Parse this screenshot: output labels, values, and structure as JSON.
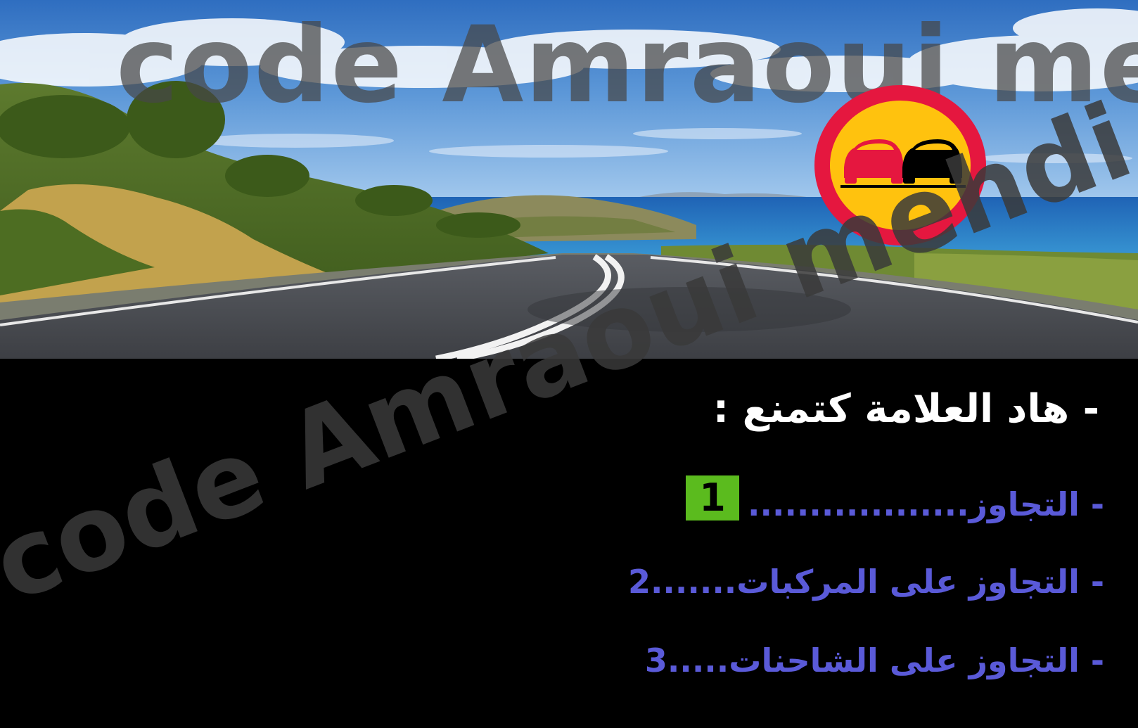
{
  "watermark": {
    "text": "code Amraoui mehdi"
  },
  "sign": {
    "icon": "no-overtaking-sign-icon",
    "ring_color": "#e5173f",
    "fill_color": "#ffc20e",
    "car_left_color": "#e5173f",
    "car_right_color": "#000000"
  },
  "question": {
    "text": "- هاد العلامة كتمنع :"
  },
  "answers": [
    {
      "text": "- التجاوز",
      "dots": "..................",
      "number": ""
    },
    {
      "text": "- التجاوز على المركبات",
      "dots": ".......",
      "number": "2"
    },
    {
      "text": "- التجاوز على الشاحنات",
      "dots": ".....",
      "number": "3"
    }
  ],
  "selected_badge": {
    "number": "1",
    "color": "#5bbb1e"
  },
  "colors": {
    "question_text": "#ffffff",
    "answer_text": "#5a5ad8",
    "panel_background": "#000000"
  }
}
